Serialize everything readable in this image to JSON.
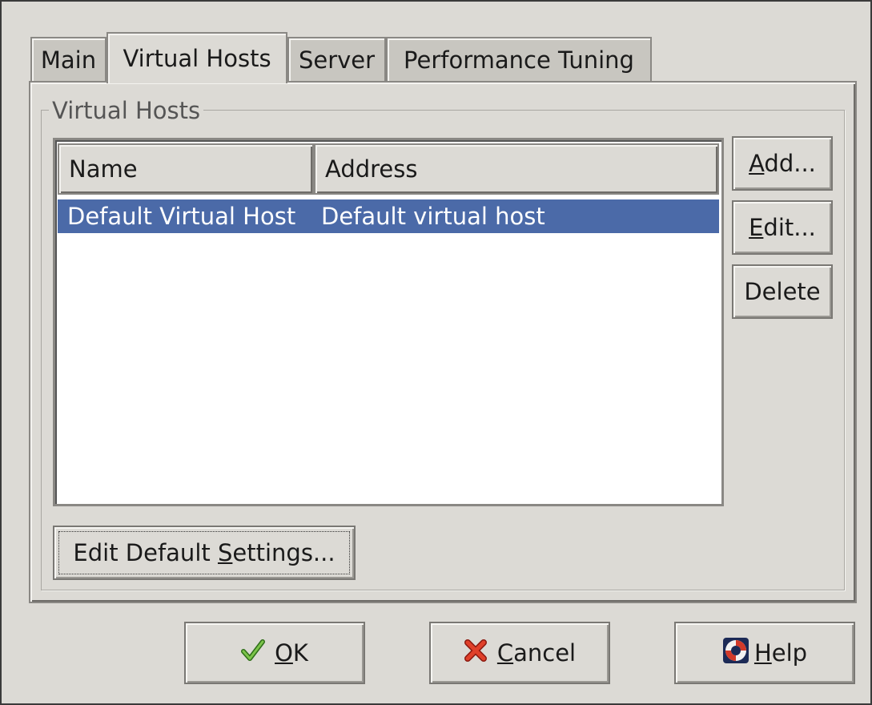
{
  "tabs": [
    {
      "label": "Main"
    },
    {
      "label": "Virtual Hosts"
    },
    {
      "label": "Server"
    },
    {
      "label": "Performance Tuning"
    }
  ],
  "group": {
    "label": "Virtual Hosts"
  },
  "list": {
    "columns": [
      {
        "label": "Name"
      },
      {
        "label": "Address"
      }
    ],
    "rows": [
      {
        "name": "Default Virtual Host",
        "address": "Default virtual host",
        "selected": true
      }
    ]
  },
  "side_buttons": {
    "add": {
      "mnemonic": "A",
      "rest": "dd..."
    },
    "edit": {
      "mnemonic": "E",
      "rest": "dit..."
    },
    "delete": {
      "label": "Delete"
    }
  },
  "edit_default": {
    "before": "Edit Default ",
    "mnemonic": "S",
    "after": "ettings..."
  },
  "dialog_buttons": {
    "ok": {
      "mnemonic": "O",
      "rest": "K",
      "icon": "check-icon"
    },
    "cancel": {
      "mnemonic": "C",
      "rest": "ancel",
      "icon": "x-icon"
    },
    "help": {
      "mnemonic": "H",
      "rest": "elp",
      "icon": "lifebuoy-icon"
    }
  },
  "colors": {
    "selection": "#4b6aa8",
    "window_bg": "#dcdad5"
  }
}
